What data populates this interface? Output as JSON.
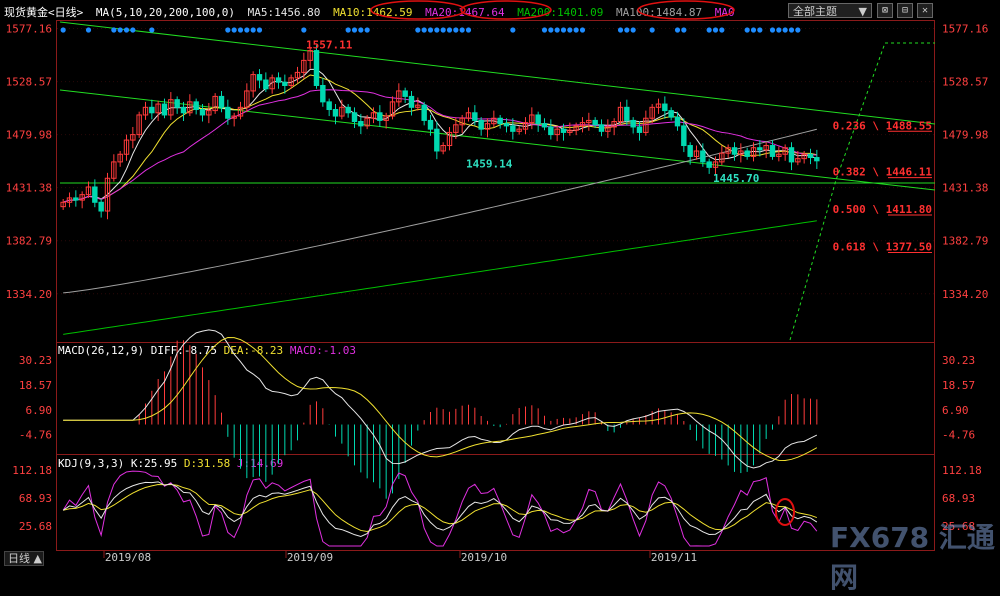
{
  "header": {
    "symbol": "现货黄金",
    "period_tag": "<日线>",
    "ma_params": "MA(5,10,20,200,100,0)",
    "ma5": "MA5:1456.80",
    "ma10": "MA10:1462.59",
    "ma20": "MA20:1467.64",
    "ma200": "MA200:1401.09",
    "ma100": "MA100:1484.87",
    "ma0": "MA0",
    "theme_button": "全部主题",
    "buttons": [
      "⊠",
      "⊟",
      "✕"
    ]
  },
  "colors": {
    "up": "#ff3b3b",
    "down": "#00d8b0",
    "ma5": "#e6e6e6",
    "ma10": "#f0e030",
    "ma20": "#e030e0",
    "ma200": "#00c000",
    "ma100": "#a0a0a0",
    "channel": "#22dd22",
    "fib": "#ff3030",
    "axis_text": "#ff4040",
    "ellipse": "#e01010"
  },
  "price_axis": {
    "ticks": [
      "1577.16",
      "1528.57",
      "1479.98",
      "1431.38",
      "1382.79",
      "1334.20"
    ],
    "range": [
      1290,
      1585
    ]
  },
  "annotations": {
    "high": "1557.11",
    "low1": "1459.14",
    "low2": "1445.70"
  },
  "fib_levels": [
    {
      "ratio": "0.236",
      "price": "1488.55"
    },
    {
      "ratio": "0.382",
      "price": "1446.11"
    },
    {
      "ratio": "0.500",
      "price": "1411.80"
    },
    {
      "ratio": "0.618",
      "price": "1377.50"
    }
  ],
  "macd": {
    "title": "MACD(26,12,9)",
    "diff": "DIFF:-8.75",
    "dea": "DEA:-8.23",
    "macd": "MACD:-1.03",
    "ticks": [
      "30.23",
      "18.57",
      "6.90",
      "-4.76"
    ]
  },
  "kdj": {
    "title": "KDJ(9,3,3)",
    "k": "K:25.95",
    "d": "D:31.58",
    "j": "J:14.69",
    "ticks": [
      "112.18",
      "68.93",
      "25.68"
    ]
  },
  "x_axis": {
    "labels": [
      "2019/08",
      "2019/09",
      "2019/10",
      "2019/11"
    ]
  },
  "period_selector": "日线 ▲",
  "watermark": "FX678 汇通网",
  "chart_data": {
    "type": "candlestick",
    "title": "现货黄金<日线>",
    "y_range": [
      1290,
      1585
    ],
    "x_labels": [
      "2019/08",
      "2019/09",
      "2019/10",
      "2019/11"
    ],
    "series": [
      {
        "name": "MA5",
        "last": 1456.8
      },
      {
        "name": "MA10",
        "last": 1462.59
      },
      {
        "name": "MA20",
        "last": 1467.64
      },
      {
        "name": "MA200",
        "last": 1401.09
      },
      {
        "name": "MA100",
        "last": 1484.87
      }
    ],
    "closes": [
      1418,
      1422,
      1420,
      1425,
      1432,
      1418,
      1410,
      1440,
      1455,
      1462,
      1475,
      1480,
      1498,
      1505,
      1500,
      1508,
      1498,
      1512,
      1505,
      1500,
      1510,
      1503,
      1498,
      1502,
      1515,
      1505,
      1495,
      1497,
      1505,
      1520,
      1535,
      1530,
      1522,
      1532,
      1528,
      1525,
      1532,
      1537,
      1548,
      1557,
      1525,
      1510,
      1503,
      1497,
      1505,
      1500,
      1492,
      1488,
      1495,
      1500,
      1493,
      1497,
      1510,
      1520,
      1515,
      1505,
      1507,
      1493,
      1485,
      1465,
      1470,
      1482,
      1489,
      1495,
      1500,
      1493,
      1485,
      1490,
      1495,
      1490,
      1488,
      1483,
      1485,
      1491,
      1498,
      1490,
      1487,
      1480,
      1485,
      1482,
      1484,
      1488,
      1491,
      1493,
      1489,
      1483,
      1487,
      1492,
      1505,
      1493,
      1487,
      1482,
      1495,
      1505,
      1508,
      1502,
      1496,
      1488,
      1470,
      1460,
      1465,
      1455,
      1450,
      1455,
      1463,
      1468,
      1462,
      1465,
      1460,
      1468,
      1466,
      1470,
      1460,
      1462,
      1468,
      1455,
      1458,
      1462,
      1459,
      1456
    ],
    "macd_hist_range": [
      -12,
      12
    ],
    "kdj_range": [
      -5,
      115
    ]
  }
}
